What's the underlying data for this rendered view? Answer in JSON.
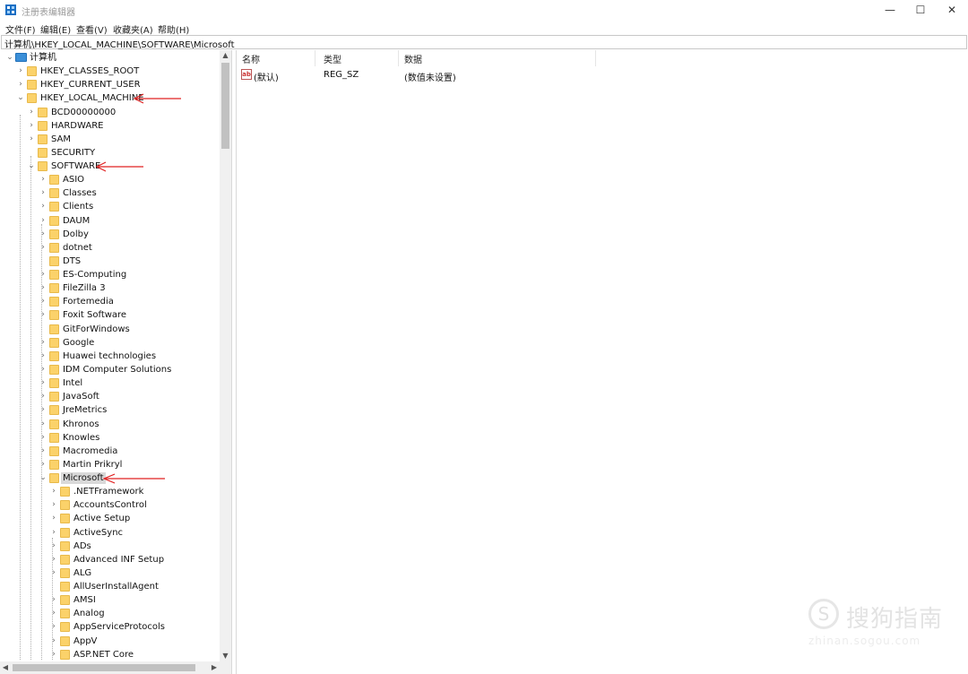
{
  "window": {
    "title": "注册表编辑器",
    "controls": {
      "minimize": "—",
      "maximize": "☐",
      "close": "✕"
    }
  },
  "menu": [
    "文件(F)",
    "编辑(E)",
    "查看(V)",
    "收藏夹(A)",
    "帮助(H)"
  ],
  "address": "计算机\\HKEY_LOCAL_MACHINE\\SOFTWARE\\Microsoft",
  "tree": {
    "root": "计算机",
    "hives": [
      "HKEY_CLASSES_ROOT",
      "HKEY_CURRENT_USER",
      "HKEY_LOCAL_MACHINE"
    ],
    "hklm_children": [
      "BCD00000000",
      "HARDWARE",
      "SAM",
      "SECURITY",
      "SOFTWARE"
    ],
    "software_children": [
      "ASIO",
      "Classes",
      "Clients",
      "DAUM",
      "Dolby",
      "dotnet",
      "DTS",
      "ES-Computing",
      "FileZilla 3",
      "Fortemedia",
      "Foxit Software",
      "GitForWindows",
      "Google",
      "Huawei technologies",
      "IDM Computer Solutions",
      "Intel",
      "JavaSoft",
      "JreMetrics",
      "Khronos",
      "Knowles",
      "Macromedia",
      "Martin Prikryl",
      "Microsoft"
    ],
    "microsoft_children": [
      ".NETFramework",
      "AccountsControl",
      "Active Setup",
      "ActiveSync",
      "ADs",
      "Advanced INF Setup",
      "ALG",
      "AllUserInstallAgent",
      "AMSI",
      "Analog",
      "AppServiceProtocols",
      "AppV",
      "ASP.NET Core"
    ],
    "selected": "Microsoft"
  },
  "list": {
    "columns": {
      "name": "名称",
      "type": "类型",
      "data": "数据"
    },
    "rows": [
      {
        "icon": "ab",
        "name": "(默认)",
        "type": "REG_SZ",
        "data": "(数值未设置)"
      }
    ]
  },
  "scrollbar": {
    "up": "▲",
    "down": "▼",
    "left": "◀",
    "right": "▶"
  },
  "watermark": {
    "text": "搜狗指南",
    "url": "zhinan.sogou.com",
    "glyph": "S"
  },
  "colors": {
    "folder": "#fbd26a",
    "arrow": "#e02020",
    "selection": "#d9d9d9"
  }
}
